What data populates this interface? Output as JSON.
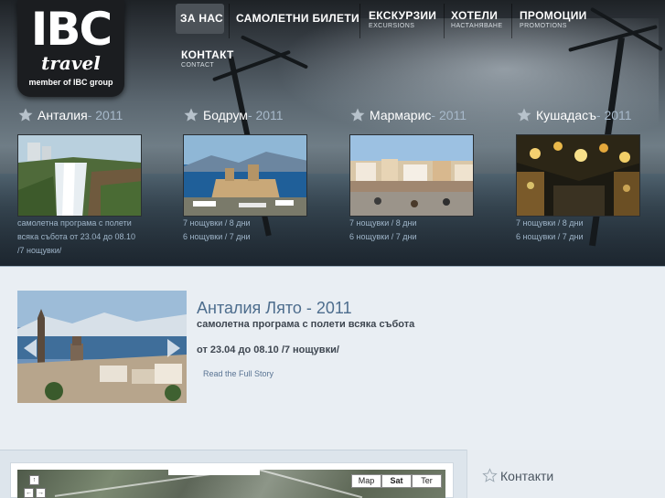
{
  "logo": {
    "brand": "IBC",
    "script": "travel",
    "tagline": "member of IBC group"
  },
  "nav": [
    {
      "label": "ЗА НАС",
      "sub": "",
      "active": true
    },
    {
      "label": "САМОЛЕТНИ БИЛЕТИ",
      "sub": ""
    },
    {
      "label": "ЕКСКУРЗИИ",
      "sub": "EXCURSIONS"
    },
    {
      "label": "ХОТЕЛИ",
      "sub": "НАСТАНЯВАНЕ"
    },
    {
      "label": "ПРОМОЦИИ",
      "sub": "PROMOTIONS"
    },
    {
      "label": "КОНТАКТ",
      "sub": "CONTACT"
    }
  ],
  "destinations": [
    {
      "name": "Анталия",
      "year": " - 2011",
      "lines": [
        "самолетна програма с полети",
        "всяка събота от 23.04 до 08.10",
        "/7 нощувки/"
      ]
    },
    {
      "name": "Бодрум",
      "year": " - 2011",
      "lines": [
        "7 нощувки / 8 дни",
        "6 нощувки / 7 дни"
      ]
    },
    {
      "name": "Мармарис",
      "year": " - 2011",
      "lines": [
        "7 нощувки / 8 дни",
        "6 нощувки / 7 дни"
      ]
    },
    {
      "name": "Кушадасъ",
      "year": " - 2011",
      "lines": [
        "7 нощувки / 8 дни",
        "6 нощувки / 7 дни"
      ]
    }
  ],
  "feature": {
    "title": "Анталия Лято - 2011",
    "line1": "самолетна програма с полети всяка събота",
    "line2": "от 23.04 до 08.10 /7 нощувки/",
    "link": "Read the Full Story"
  },
  "map": {
    "buttons": [
      "Map",
      "Sat",
      "Ter"
    ],
    "active": "Sat"
  },
  "contacts": {
    "title": "Контакти"
  },
  "colors": {
    "accent": "#4d6d8d",
    "info_text": "#9eb4c8",
    "year": "#a7b9ca"
  }
}
